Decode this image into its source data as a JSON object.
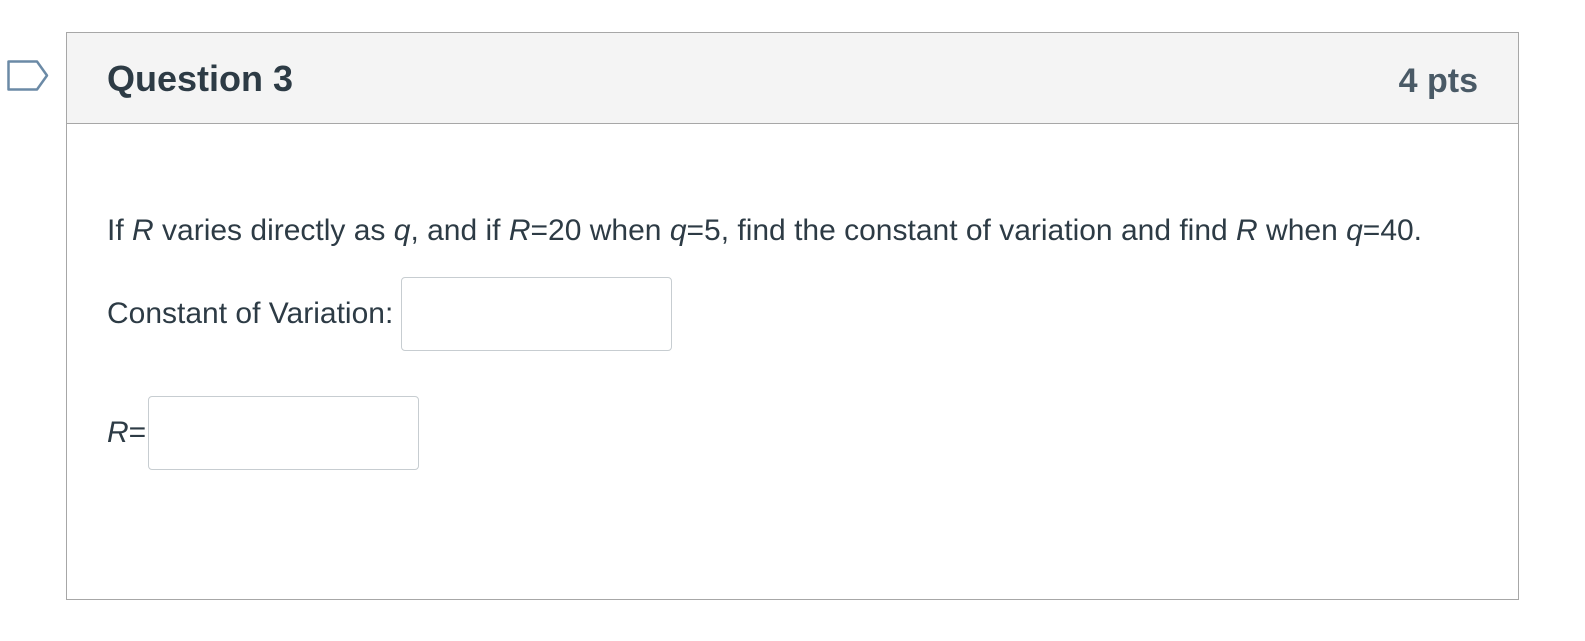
{
  "question": {
    "title": "Question 3",
    "points": "4 pts",
    "text_parts": {
      "p1": "If ",
      "v1": "R",
      "p2": " varies directly as ",
      "v2": "q",
      "p3": ", and if ",
      "v3": "R",
      "p4": "=20 when ",
      "v4": "q",
      "p5": "=5, find the constant of variation and find ",
      "v5": "R",
      "p6": " when ",
      "v6": "q",
      "p7": "=40."
    },
    "constant_label": "Constant of Variation:",
    "constant_value": "",
    "r_var": "R",
    "r_eq": "=",
    "r_value": ""
  },
  "icons": {
    "flag": "bookmark-flag-icon"
  },
  "colors": {
    "header_bg": "#f4f4f4",
    "border": "#a7a7a7",
    "text": "#2d3b45",
    "flag_stroke": "#6b8aa6"
  }
}
